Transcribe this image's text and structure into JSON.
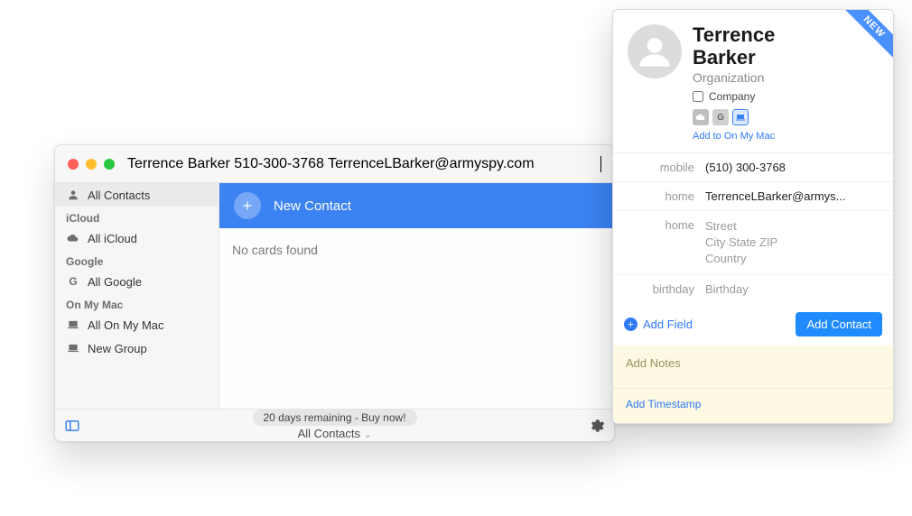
{
  "window": {
    "search_value": "Terrence Barker 510-300-3768 TerrenceLBarker@armyspy.com"
  },
  "sidebar": {
    "items": [
      {
        "type": "item",
        "label": "All Contacts",
        "icon": "person-stack",
        "selected": true
      },
      {
        "type": "group",
        "label": "iCloud"
      },
      {
        "type": "item",
        "label": "All iCloud",
        "icon": "cloud"
      },
      {
        "type": "group",
        "label": "Google"
      },
      {
        "type": "item",
        "label": "All Google",
        "icon": "g"
      },
      {
        "type": "group",
        "label": "On My Mac"
      },
      {
        "type": "item",
        "label": "All On My Mac",
        "icon": "mac"
      },
      {
        "type": "item",
        "label": "New Group",
        "icon": "mac"
      }
    ]
  },
  "content": {
    "new_contact_label": "New Contact",
    "no_cards": "No cards found"
  },
  "bottom": {
    "trial": "20 days remaining - Buy now!",
    "filter": "All Contacts"
  },
  "card": {
    "ribbon": "NEW",
    "name_first": "Terrence",
    "name_last": "Barker",
    "org_placeholder": "Organization",
    "company_label": "Company",
    "add_to_link": "Add to On My Mac",
    "fields": {
      "mobile": {
        "label": "mobile",
        "value": "(510) 300-3768"
      },
      "email": {
        "label": "home",
        "value": "TerrenceLBarker@armys..."
      },
      "address": {
        "label": "home",
        "street": "Street",
        "line2": "City  State  ZIP",
        "country": "Country"
      },
      "birthday": {
        "label": "birthday",
        "value": "Birthday"
      }
    },
    "add_field": "Add Field",
    "add_contact": "Add Contact",
    "notes_placeholder": "Add Notes",
    "timestamp": "Add Timestamp"
  }
}
